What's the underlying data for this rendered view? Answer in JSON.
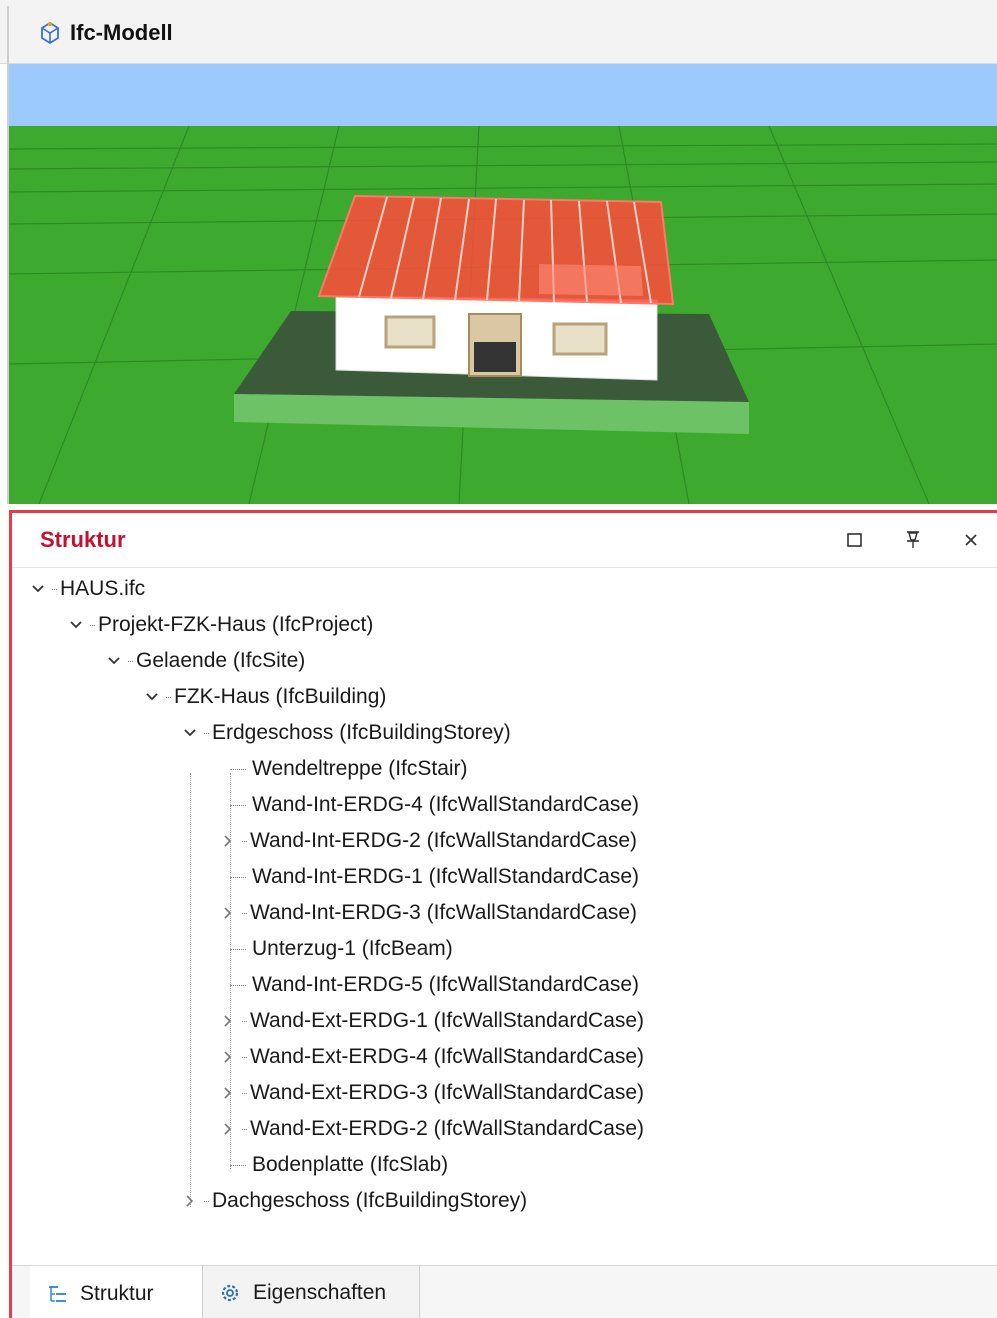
{
  "editor_tab": {
    "title": "Ifc-Modell",
    "icon": "ifc-model-icon"
  },
  "viewport": {
    "description_colors": {
      "sky": "#9ccaff",
      "ground": "#3daa2f",
      "roof": "#ff4a3a",
      "wall": "#ffffff",
      "plate": "#6cc265"
    }
  },
  "panel": {
    "title": "Struktur",
    "buttons": {
      "maximize_icon": "maximize-icon",
      "pin_icon": "pin-icon",
      "close_icon": "close-icon"
    }
  },
  "tree": {
    "root": "HAUS.ifc",
    "project": "Projekt-FZK-Haus (IfcProject)",
    "site": "Gelaende (IfcSite)",
    "building": "FZK-Haus (IfcBuilding)",
    "storey1": "Erdgeschoss (IfcBuildingStorey)",
    "items": [
      {
        "label": "Wendeltreppe (IfcStair)",
        "expandable": false
      },
      {
        "label": "Wand-Int-ERDG-4 (IfcWallStandardCase)",
        "expandable": false
      },
      {
        "label": "Wand-Int-ERDG-2 (IfcWallStandardCase)",
        "expandable": true
      },
      {
        "label": "Wand-Int-ERDG-1 (IfcWallStandardCase)",
        "expandable": false
      },
      {
        "label": "Wand-Int-ERDG-3 (IfcWallStandardCase)",
        "expandable": true
      },
      {
        "label": "Unterzug-1 (IfcBeam)",
        "expandable": false
      },
      {
        "label": "Wand-Int-ERDG-5 (IfcWallStandardCase)",
        "expandable": false
      },
      {
        "label": "Wand-Ext-ERDG-1 (IfcWallStandardCase)",
        "expandable": true
      },
      {
        "label": "Wand-Ext-ERDG-4 (IfcWallStandardCase)",
        "expandable": true
      },
      {
        "label": "Wand-Ext-ERDG-3 (IfcWallStandardCase)",
        "expandable": true
      },
      {
        "label": "Wand-Ext-ERDG-2 (IfcWallStandardCase)",
        "expandable": true
      },
      {
        "label": "Bodenplatte (IfcSlab)",
        "expandable": false
      }
    ],
    "storey2": "Dachgeschoss (IfcBuildingStorey)"
  },
  "bottom_tabs": [
    {
      "label": "Struktur",
      "icon": "tree-structure-icon"
    },
    {
      "label": "Eigenschaften",
      "icon": "properties-gear-icon"
    }
  ]
}
